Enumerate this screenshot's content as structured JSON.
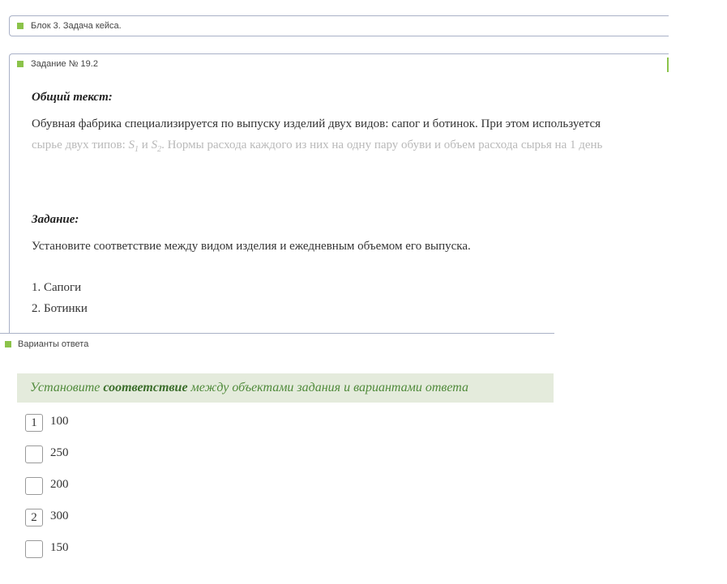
{
  "block": {
    "title": "Блок 3. Задача кейса."
  },
  "task": {
    "header": "Задание № 19.2",
    "general_heading": "Общий текст:",
    "general_line1": "Обувная фабрика специализируется по выпуску изделий двух видов: сапог и ботинок. При этом используется",
    "general_line2_pre": "сырье двух типов:",
    "s1_base": "S",
    "s1_sub": "1",
    "and_word": "и",
    "s2_base": "S",
    "s2_sub": "2",
    "general_line2_post": ". Нормы расхода каждого из них на одну пару обуви и объем расхода сырья на 1 день",
    "task_heading": "Задание:",
    "task_text": "Установите соответствие между видом изделия и ежедневным объемом его выпуска.",
    "items": [
      "1. Сапоги",
      "2. Ботинки"
    ]
  },
  "answers": {
    "header": "Варианты ответа",
    "instruction_pre": "Установите",
    "instruction_bold": "соответствие",
    "instruction_post": "между объектами задания и вариантами ответа",
    "options": [
      {
        "box": "1",
        "value": "100"
      },
      {
        "box": "",
        "value": "250"
      },
      {
        "box": "",
        "value": "200"
      },
      {
        "box": "2",
        "value": "300"
      },
      {
        "box": "",
        "value": "150"
      }
    ]
  },
  "colors": {
    "accent_green": "#8bc34a",
    "border": "#a9b1c7",
    "instruction_bg": "#e4ebdc",
    "instruction_text": "#4f8a3a"
  }
}
